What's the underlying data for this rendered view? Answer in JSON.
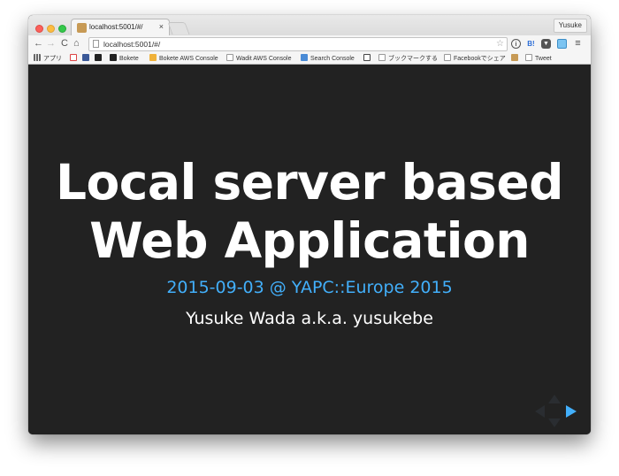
{
  "browser": {
    "tab_title": "localhost:5001/#/",
    "tab_close": "×",
    "profile_name": "Yusuke",
    "url": "localhost:5001/#/",
    "nav": {
      "back": "←",
      "forward": "→",
      "reload": "C",
      "home": "⌂"
    },
    "extensions": {
      "hatena": "B!",
      "menu": "≡"
    },
    "bookmarks": [
      {
        "label": "アプリ",
        "icon": "apps-icon"
      },
      {
        "label": "",
        "icon": "gmail-icon"
      },
      {
        "label": "",
        "icon": "facebook-icon"
      },
      {
        "label": "",
        "icon": "github-icon"
      },
      {
        "label": "Bokete",
        "icon": "github-icon"
      },
      {
        "label": "Bokete AWS Console",
        "icon": "bokete-icon"
      },
      {
        "label": "Wadit AWS Console",
        "icon": "page-icon"
      },
      {
        "label": "Search Console",
        "icon": "search-console-icon"
      },
      {
        "label": "",
        "icon": "info-icon"
      },
      {
        "label": "ブックマークする",
        "icon": "page-icon"
      },
      {
        "label": "Facebookでシェア",
        "icon": "page-icon"
      },
      {
        "label": "",
        "icon": "bear-icon"
      },
      {
        "label": "Tweet",
        "icon": "page-icon"
      }
    ]
  },
  "slide": {
    "title_line1": "Local server based",
    "title_line2": "Web Application",
    "date_event": "2015-09-03 @ YAPC::Europe 2015",
    "author": "Yusuke Wada a.k.a. yusukebe"
  },
  "colors": {
    "slide_background": "#222222",
    "accent": "#42affa",
    "title_text": "#ffffff"
  }
}
